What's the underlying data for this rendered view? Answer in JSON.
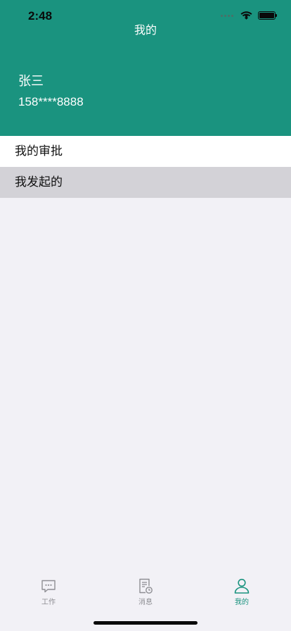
{
  "status_bar": {
    "time": "2:48"
  },
  "nav": {
    "title": "我的"
  },
  "profile": {
    "name": "张三",
    "phone": "158****8888"
  },
  "menu": {
    "items": [
      {
        "label": "我的审批"
      },
      {
        "label": "我发起的"
      }
    ]
  },
  "tabbar": {
    "tabs": [
      {
        "label": "工作",
        "icon": "chat-bubble-icon"
      },
      {
        "label": "消息",
        "icon": "document-clock-icon"
      },
      {
        "label": "我的",
        "icon": "person-icon",
        "active": true
      }
    ]
  },
  "colors": {
    "brand": "#1a937f",
    "background": "#f2f1f6",
    "pressed_row": "#d3d2d7",
    "inactive_tab": "#8e8e93"
  }
}
